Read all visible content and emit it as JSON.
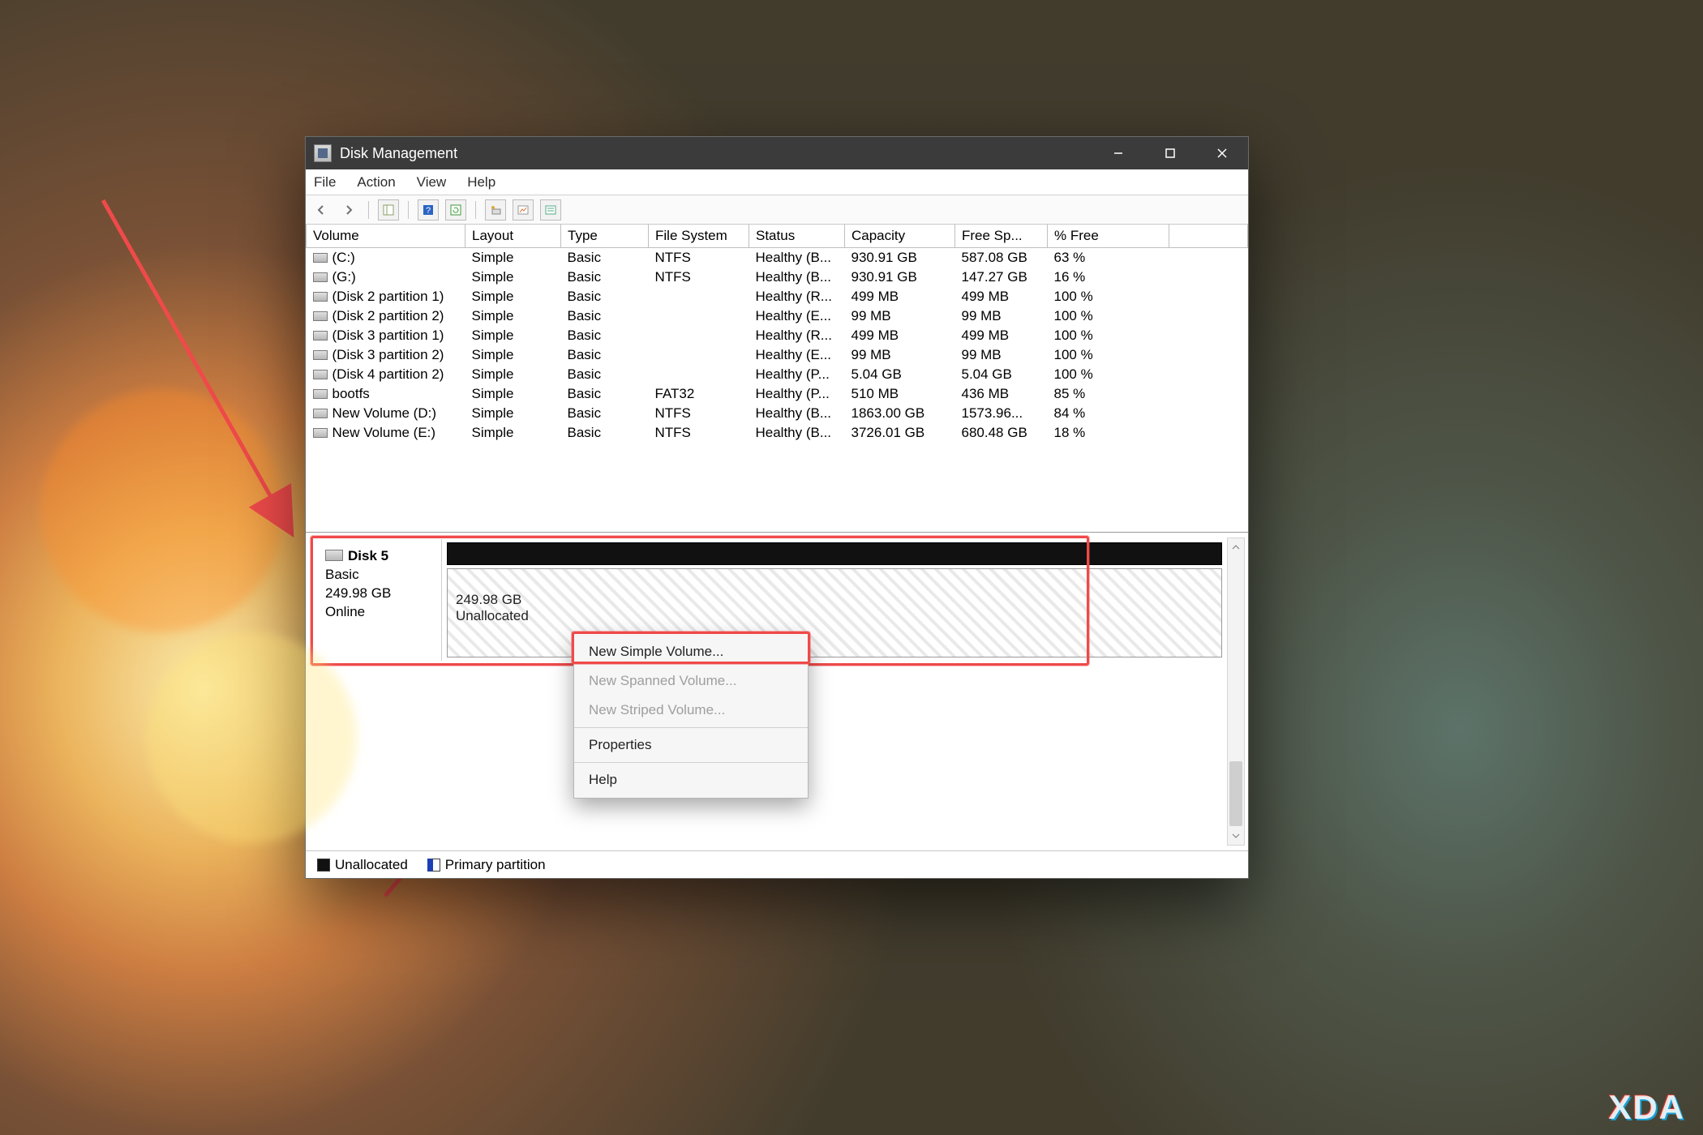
{
  "wallpaper_hint": "fantasy-forest-painting",
  "watermark": "XDA",
  "window": {
    "title": "Disk Management",
    "controls": {
      "minimize": "min",
      "maximize": "max",
      "close": "close"
    }
  },
  "menubar": [
    "File",
    "Action",
    "View",
    "Help"
  ],
  "toolbar_icons": [
    "back",
    "forward",
    "show-hide-tree",
    "help",
    "refresh",
    "properties",
    "settings",
    "details"
  ],
  "volume_table": {
    "columns": [
      "Volume",
      "Layout",
      "Type",
      "File System",
      "Status",
      "Capacity",
      "Free Sp...",
      "% Free"
    ],
    "rows": [
      {
        "name": "(C:)",
        "layout": "Simple",
        "type": "Basic",
        "fs": "NTFS",
        "status": "Healthy (B...",
        "capacity": "930.91 GB",
        "free": "587.08 GB",
        "pct": "63 %"
      },
      {
        "name": "(G:)",
        "layout": "Simple",
        "type": "Basic",
        "fs": "NTFS",
        "status": "Healthy (B...",
        "capacity": "930.91 GB",
        "free": "147.27 GB",
        "pct": "16 %"
      },
      {
        "name": "(Disk 2 partition 1)",
        "layout": "Simple",
        "type": "Basic",
        "fs": "",
        "status": "Healthy (R...",
        "capacity": "499 MB",
        "free": "499 MB",
        "pct": "100 %"
      },
      {
        "name": "(Disk 2 partition 2)",
        "layout": "Simple",
        "type": "Basic",
        "fs": "",
        "status": "Healthy (E...",
        "capacity": "99 MB",
        "free": "99 MB",
        "pct": "100 %"
      },
      {
        "name": "(Disk 3 partition 1)",
        "layout": "Simple",
        "type": "Basic",
        "fs": "",
        "status": "Healthy (R...",
        "capacity": "499 MB",
        "free": "499 MB",
        "pct": "100 %"
      },
      {
        "name": "(Disk 3 partition 2)",
        "layout": "Simple",
        "type": "Basic",
        "fs": "",
        "status": "Healthy (E...",
        "capacity": "99 MB",
        "free": "99 MB",
        "pct": "100 %"
      },
      {
        "name": "(Disk 4 partition 2)",
        "layout": "Simple",
        "type": "Basic",
        "fs": "",
        "status": "Healthy (P...",
        "capacity": "5.04 GB",
        "free": "5.04 GB",
        "pct": "100 %"
      },
      {
        "name": "bootfs",
        "layout": "Simple",
        "type": "Basic",
        "fs": "FAT32",
        "status": "Healthy (P...",
        "capacity": "510 MB",
        "free": "436 MB",
        "pct": "85 %"
      },
      {
        "name": "New Volume (D:)",
        "layout": "Simple",
        "type": "Basic",
        "fs": "NTFS",
        "status": "Healthy (B...",
        "capacity": "1863.00 GB",
        "free": "1573.96...",
        "pct": "84 %"
      },
      {
        "name": "New Volume (E:)",
        "layout": "Simple",
        "type": "Basic",
        "fs": "NTFS",
        "status": "Healthy (B...",
        "capacity": "3726.01 GB",
        "free": "680.48 GB",
        "pct": "18 %"
      }
    ]
  },
  "disk_graphic": {
    "disk_name": "Disk 5",
    "disk_type": "Basic",
    "disk_size": "249.98 GB",
    "disk_status": "Online",
    "partition_size": "249.98 GB",
    "partition_state": "Unallocated"
  },
  "context_menu": {
    "items": [
      {
        "label": "New Simple Volume...",
        "state": "enabled",
        "highlighted": true
      },
      {
        "label": "New Spanned Volume...",
        "state": "disabled"
      },
      {
        "label": "New Striped Volume...",
        "state": "disabled"
      },
      {
        "label": "Properties",
        "state": "enabled"
      },
      {
        "label": "Help",
        "state": "enabled"
      }
    ]
  },
  "legend": {
    "unallocated": "Unallocated",
    "primary": "Primary partition"
  },
  "annotation_color": "#ef4a4a"
}
